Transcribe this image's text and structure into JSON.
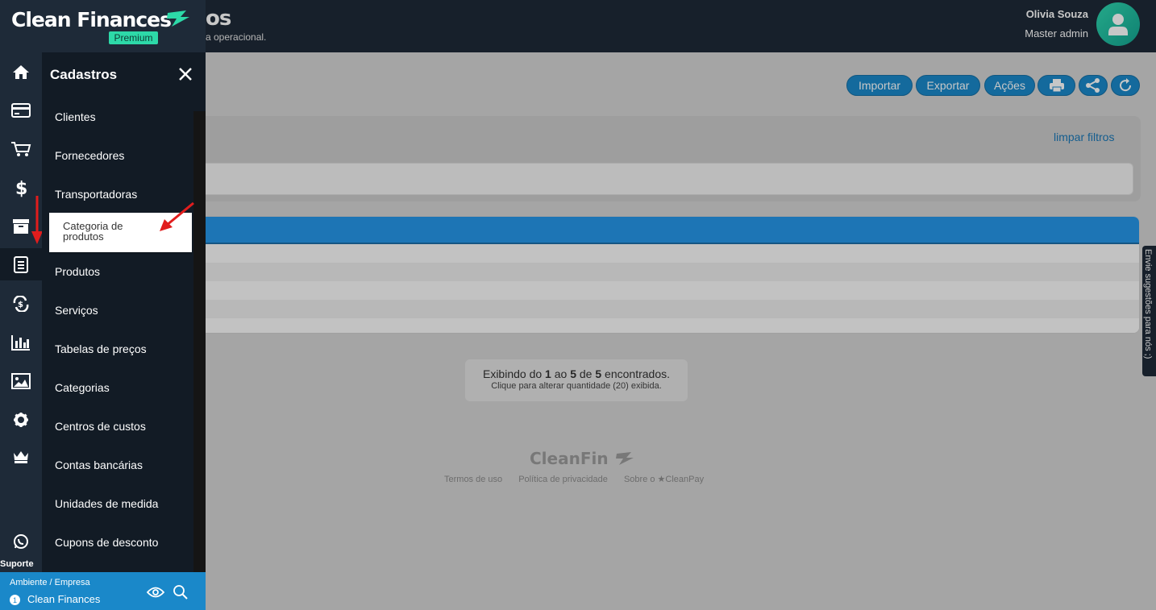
{
  "header": {
    "title": "os",
    "subtitle": "a operacional.",
    "user_name": "Olivia Souza",
    "user_role": "Master admin"
  },
  "brand": {
    "name": "Clean Finances",
    "badge": "Premium"
  },
  "actions": {
    "import_label": "Importar",
    "export_label": "Exportar",
    "actions_label": "Ações"
  },
  "filters": {
    "clear_label": "limpar filtros"
  },
  "pagination": {
    "prefix": "Exibindo do",
    "from": "1",
    "mid1": "ao",
    "to": "5",
    "mid2": "de",
    "total": "5",
    "suffix": "encontrados.",
    "hint": "Clique para alterar quantidade (20) exibida."
  },
  "footer": {
    "brand": "CleanFin",
    "links": [
      "Termos de uso",
      "Política de privacidade",
      "Sobre o ★CleanPay"
    ]
  },
  "feedback": {
    "label": "Envie sugestões para nós ;)"
  },
  "rail": {
    "support_label": "Suporte",
    "icons": [
      "home-icon",
      "credit-card-icon",
      "cart-icon",
      "dollar-icon",
      "archive-icon",
      "register-icon",
      "transfer-icon",
      "chart-icon",
      "image-icon",
      "gear-icon",
      "crown-icon",
      "whatsapp-icon"
    ]
  },
  "submenu": {
    "title": "Cadastros",
    "items": [
      "Clientes",
      "Fornecedores",
      "Transportadoras",
      "Categoria de produtos",
      "Produtos",
      "Serviços",
      "Tabelas de preços",
      "Categorias",
      "Centros de custos",
      "Contas bancárias",
      "Unidades de medida",
      "Cupons de desconto"
    ]
  },
  "environment": {
    "label": "Ambiente / Empresa",
    "number": "1",
    "value": "Clean Finances"
  },
  "colors": {
    "primary": "#1a88c9",
    "dark": "#1e2a38",
    "accent": "#2dd9a8",
    "annotation": "#e11d1d"
  }
}
